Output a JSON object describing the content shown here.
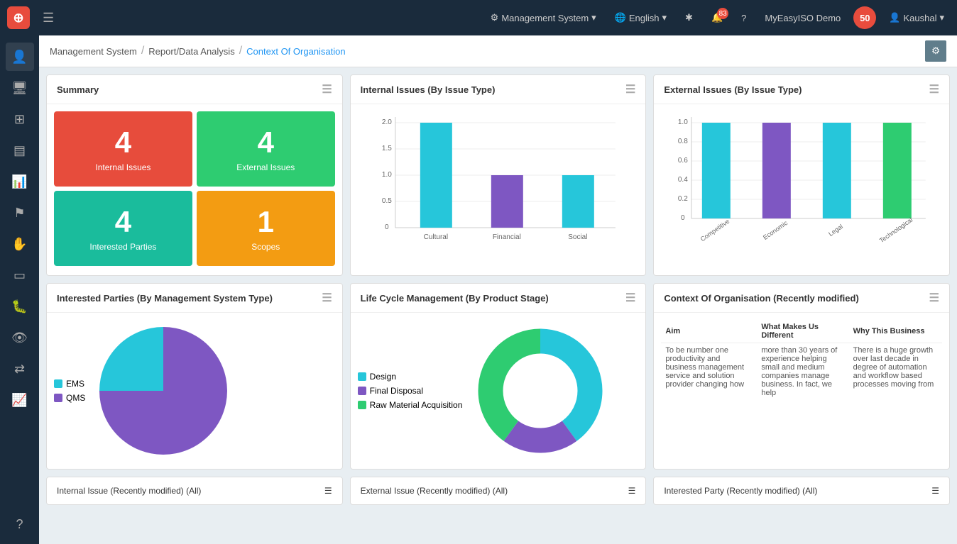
{
  "topNav": {
    "appName": "Management System",
    "language": "English",
    "notifCount": "83",
    "userName": "Kaushal",
    "instanceName": "MyEasyISO Demo"
  },
  "breadcrumb": {
    "root": "Management System",
    "section": "Report/Data Analysis",
    "current": "Context Of Organisation"
  },
  "summary": {
    "title": "Summary",
    "tiles": [
      {
        "label": "Internal Issues",
        "value": "4",
        "color": "tile-red"
      },
      {
        "label": "External Issues",
        "value": "4",
        "color": "tile-green"
      },
      {
        "label": "Interested Parties",
        "value": "4",
        "color": "tile-teal"
      },
      {
        "label": "Scopes",
        "value": "1",
        "color": "tile-orange"
      }
    ]
  },
  "internalIssues": {
    "title": "Internal Issues (By Issue Type)",
    "bars": [
      {
        "label": "Cultural",
        "value": 2.0,
        "color": "#26c6da"
      },
      {
        "label": "Financial",
        "value": 1.0,
        "color": "#7e57c2"
      },
      {
        "label": "Social",
        "value": 1.0,
        "color": "#26c6da"
      }
    ],
    "yMax": 2.0,
    "yLabels": [
      "2.0",
      "1.5",
      "1.0",
      "0.5",
      "0"
    ]
  },
  "externalIssues": {
    "title": "External Issues (By Issue Type)",
    "bars": [
      {
        "label": "Competitive",
        "value": 1.0,
        "color": "#26c6da"
      },
      {
        "label": "Economic",
        "value": 1.0,
        "color": "#7e57c2"
      },
      {
        "label": "Legal",
        "value": 1.0,
        "color": "#26c6da"
      },
      {
        "label": "Technological",
        "value": 1.0,
        "color": "#2ecc71"
      }
    ],
    "yMax": 1.0,
    "yLabels": [
      "1.0",
      "0.8",
      "0.6",
      "0.4",
      "0.2",
      "0"
    ]
  },
  "interestedParties": {
    "title": "Interested Parties (By Management System Type)",
    "legend": [
      {
        "label": "EMS",
        "color": "#26c6da"
      },
      {
        "label": "QMS",
        "color": "#7e57c2"
      }
    ],
    "pieData": [
      {
        "label": "EMS",
        "value": 25,
        "color": "#26c6da"
      },
      {
        "label": "QMS",
        "value": 75,
        "color": "#7e57c2"
      }
    ]
  },
  "lifeCycle": {
    "title": "Life Cycle Management (By Product Stage)",
    "legend": [
      {
        "label": "Design",
        "color": "#26c6da"
      },
      {
        "label": "Final Disposal",
        "color": "#7e57c2"
      },
      {
        "label": "Raw Material Acquisition",
        "color": "#2ecc71"
      }
    ],
    "donutData": [
      {
        "label": "Design",
        "value": 40,
        "color": "#26c6da"
      },
      {
        "label": "Final Disposal",
        "value": 20,
        "color": "#7e57c2"
      },
      {
        "label": "Raw Material Acquisition",
        "value": 40,
        "color": "#2ecc71"
      }
    ]
  },
  "contextOrg": {
    "title": "Context Of Organisation (Recently modified)",
    "columns": [
      "Aim",
      "What Makes Us Different",
      "Why This Business"
    ],
    "row": {
      "aim": "To be number one productivity and business management service and solution provider changing how",
      "different": "more than 30 years of experience helping small and medium companies manage business. In fact, we help",
      "business": "There is a huge growth over last decade in degree of automation and workflow based processes moving from"
    }
  },
  "bottomCards": {
    "internal": "Internal Issue (Recently modified) (All)",
    "external": "External Issue (Recently modified) (All)",
    "interestedParty": "Interested Party (Recently modified) (All)"
  },
  "sidebar": {
    "icons": [
      {
        "name": "person-icon",
        "symbol": "👤"
      },
      {
        "name": "monitor-icon",
        "symbol": "🖥"
      },
      {
        "name": "hierarchy-icon",
        "symbol": "⊞"
      },
      {
        "name": "card-icon",
        "symbol": "💳"
      },
      {
        "name": "chart-icon",
        "symbol": "📊"
      },
      {
        "name": "flag-icon",
        "symbol": "🚩"
      },
      {
        "name": "hand-icon",
        "symbol": "✋"
      },
      {
        "name": "tablet-icon",
        "symbol": "📱"
      },
      {
        "name": "bug-icon",
        "symbol": "🐛"
      },
      {
        "name": "eye-icon",
        "symbol": "👁"
      },
      {
        "name": "arrows-icon",
        "symbol": "⇄"
      },
      {
        "name": "trend-icon",
        "symbol": "📈"
      },
      {
        "name": "help-icon",
        "symbol": "?"
      }
    ]
  }
}
